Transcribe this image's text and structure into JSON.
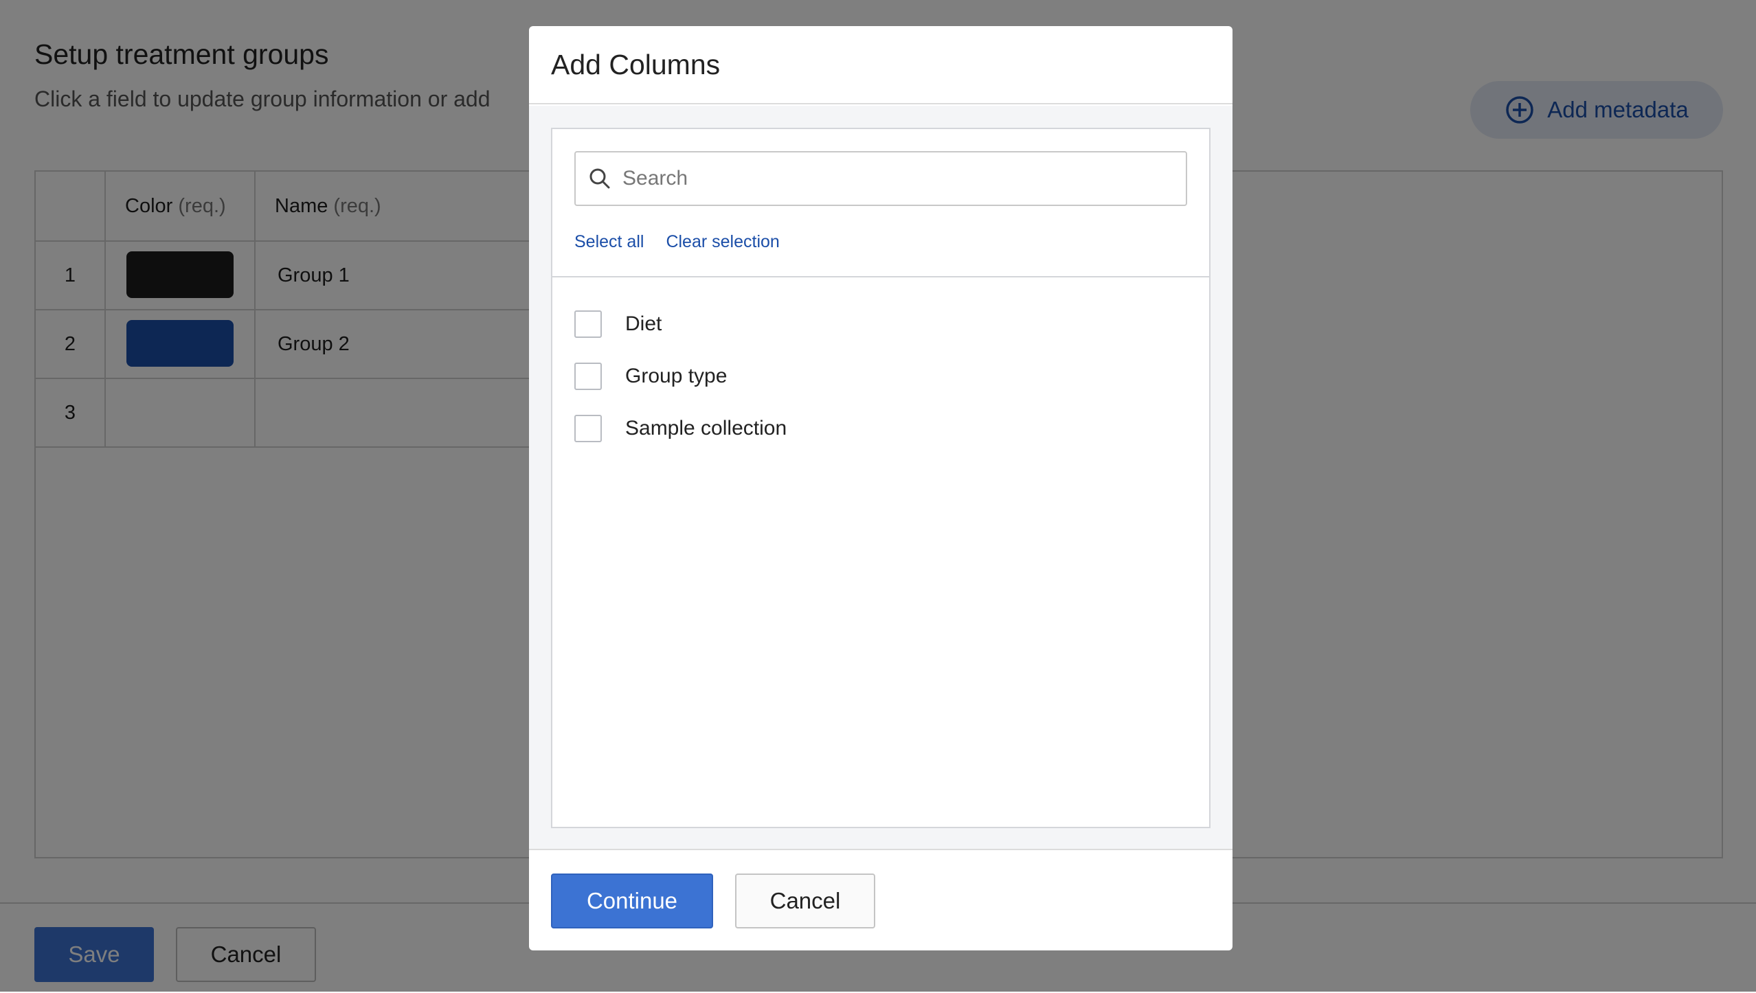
{
  "page": {
    "title": "Setup treatment groups",
    "subtitle": "Click a field to update group information or add",
    "add_metadata_label": "Add metadata"
  },
  "table": {
    "columns": [
      {
        "label": "Color",
        "req": "(req.)"
      },
      {
        "label": "Name",
        "req": "(req.)"
      }
    ],
    "rows": [
      {
        "index": "1",
        "color": "#1c1c1c",
        "name": "Group 1"
      },
      {
        "index": "2",
        "color": "#1b4ea8",
        "name": "Group 2"
      },
      {
        "index": "3",
        "color": "",
        "name": ""
      }
    ]
  },
  "footer": {
    "save_label": "Save",
    "cancel_label": "Cancel"
  },
  "modal": {
    "title": "Add Columns",
    "search_placeholder": "Search",
    "search_value": "",
    "select_all_label": "Select all",
    "clear_selection_label": "Clear selection",
    "options": [
      {
        "label": "Diet",
        "checked": false
      },
      {
        "label": "Group type",
        "checked": false
      },
      {
        "label": "Sample collection",
        "checked": false
      }
    ],
    "continue_label": "Continue",
    "cancel_label": "Cancel"
  },
  "colors": {
    "accent": "#3c73d3",
    "link": "#1b4ea8",
    "overlay": "rgba(0,0,0,0.5)"
  },
  "icons": {
    "search": "search-icon",
    "add": "plus-circle-icon"
  }
}
